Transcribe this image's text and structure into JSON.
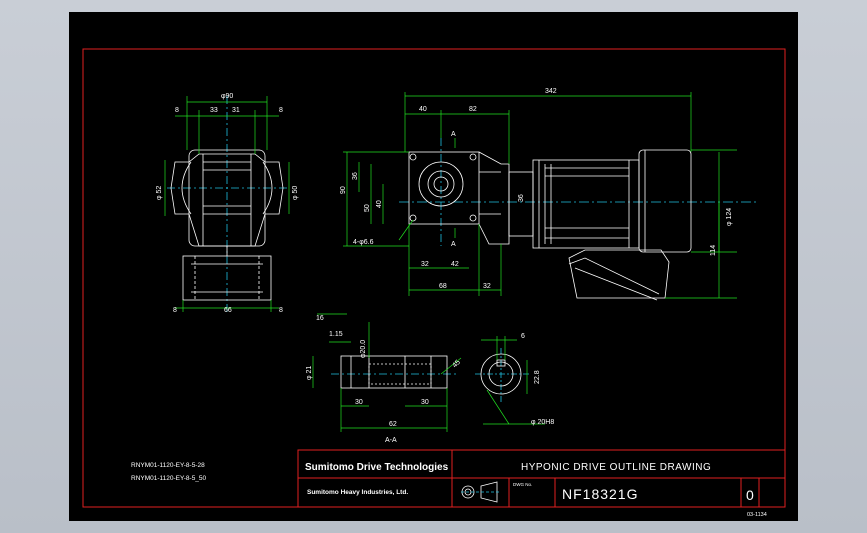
{
  "drawing": {
    "frame_color": "#e02020",
    "dim_color": "#20e020",
    "center_color": "#20c0e0",
    "geometry_color": "#ffffff",
    "note_color": "#ffffff"
  },
  "left_view": {
    "dims": {
      "top": "φ90",
      "top_left": "8",
      "top_mid_a": "33",
      "top_mid_b": "31",
      "top_right": "8",
      "left_dia": "φ 52",
      "right_dia": "φ 50",
      "bottom_left": "8",
      "bottom_mid": "66",
      "bottom_right": "8"
    }
  },
  "main_view": {
    "dims": {
      "overall_length": "342",
      "len_40": "40",
      "len_82": "82",
      "section_a_top": "A",
      "section_a_bottom": "A",
      "h_90": "90",
      "h_36": "36",
      "h_50": "50",
      "h_40": "40",
      "h_36_right": "36",
      "hole_note": "4-φ6.6",
      "b_32": "32",
      "b_42": "42",
      "b_68": "68",
      "b_32_right": "32",
      "motor_dia": "φ 124",
      "h_114": "114"
    }
  },
  "shaft_view": {
    "dims": {
      "len_16": "16",
      "chamfer": "1.15",
      "shaft_dia": "φ20.0",
      "bore_dia": "φ 21",
      "seg_30_left": "30",
      "seg_30_right": "30",
      "total_62": "62",
      "angle_45": "45",
      "section_label": "A-A"
    }
  },
  "section_view": {
    "dims": {
      "key_6": "6",
      "key_22_8": "22.8",
      "bore_dia": "φ 20H8"
    }
  },
  "notes": [
    "RNYM01-1120-EY-8-5-28",
    "RNYM01-1120-EY-8-5_50"
  ],
  "title_block": {
    "company_logo": "Sumitomo Drive Technologies",
    "company_name": "Sumitomo Heavy Industries, Ltd.",
    "title": "HYPONIC DRIVE OUTLINE DRAWING",
    "drawing_no_label": "DWG No.",
    "drawing_number": "NF18321G",
    "revision": "0",
    "sheet_code": "03-1134"
  }
}
